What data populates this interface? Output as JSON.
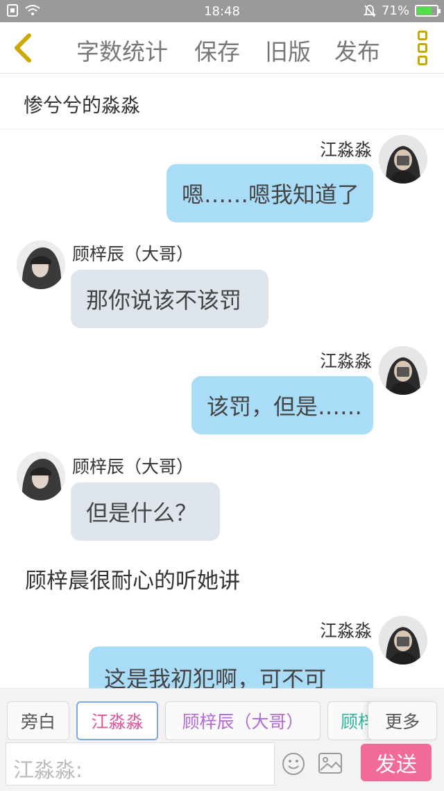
{
  "status_bar": {
    "time": "18:48",
    "battery_percent": "71%",
    "battery_level": 0.71
  },
  "toolbar": {
    "back_icon": "chevron-left-icon",
    "word_count_label": "字数统计",
    "save_label": "保存",
    "old_version_label": "旧版",
    "publish_label": "发布",
    "more_icon": "vertical-dots-icon",
    "accent_color": "#c9a800"
  },
  "chat": {
    "title": "惨兮兮的淼淼",
    "messages": [
      {
        "side": "right",
        "speaker": "江淼淼",
        "text": "嗯……嗯我知道了"
      },
      {
        "side": "left",
        "speaker": "顾梓辰（大哥）",
        "text": "那你说该不该罚"
      },
      {
        "side": "right",
        "speaker": "江淼淼",
        "text": "该罚，但是……"
      },
      {
        "side": "left",
        "speaker": "顾梓辰（大哥）",
        "text": "但是什么？"
      },
      {
        "side": "narration",
        "text": "顾梓晨很耐心的听她讲"
      },
      {
        "side": "right",
        "speaker": "江淼淼",
        "text": "这是我初犯啊，可不可"
      }
    ]
  },
  "role_bar": {
    "roles": [
      {
        "label": "旁白",
        "color": "#555555"
      },
      {
        "label": "江淼淼",
        "color": "#e0559a",
        "selected": true
      },
      {
        "label": "顾梓辰（大哥）",
        "color": "#b36ad6"
      },
      {
        "label": "顾梓",
        "color": "#2bb3a0"
      }
    ],
    "more_label": "更多"
  },
  "input": {
    "placeholder": "江淼淼:",
    "emoji_icon": "smiley-icon",
    "image_icon": "image-icon",
    "send_label": "发送",
    "send_color": "#f26a9a"
  }
}
